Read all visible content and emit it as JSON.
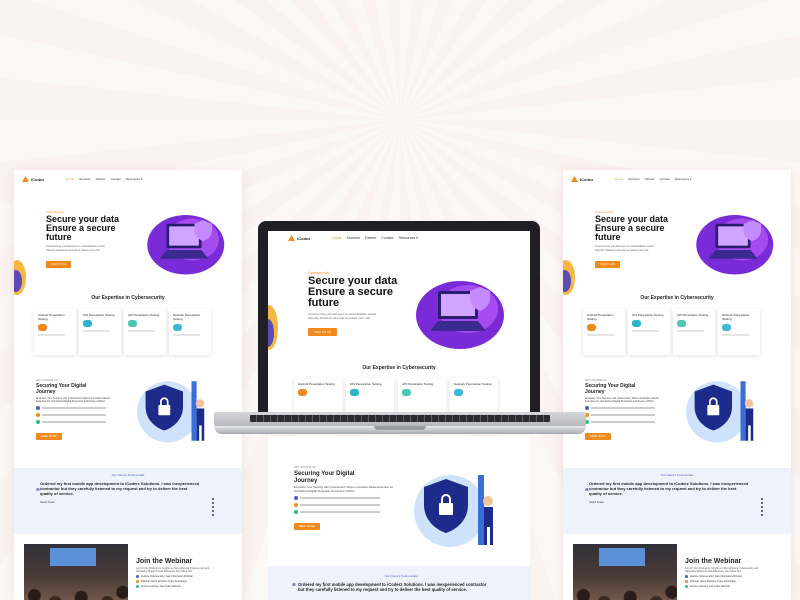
{
  "nav": {
    "logo_text": "iCodez",
    "links": [
      "Home",
      "Services",
      "Partner",
      "Contact",
      "Resources ▾"
    ]
  },
  "hero": {
    "eyebrow": "Cybersecurity",
    "title": "Secure your data Ensure a secure future",
    "text": "Avoid turning yourself open to vulnerabilities. Avoid Security Solutions can help to reduce your risk.",
    "button": "TALK TO US"
  },
  "expertise": {
    "title": "Our Expertise in Cybersecurity",
    "cards": [
      {
        "title": "Android Penetration Testing",
        "icon_color": "#f08a1c"
      },
      {
        "title": "iOS Penetration Testing",
        "icon_color": "#2bb3c9"
      },
      {
        "title": "API Penetration Testing",
        "icon_color": "#4bc7b3"
      },
      {
        "title": "Network Penetration Testing",
        "icon_color": "#3db8d8"
      }
    ]
  },
  "secure": {
    "eyebrow": "WHY CHOOSE US",
    "title": "Securing Your Digital Journey",
    "text": "Empower Your Security with CyberGuard: Where Innovation Meets Expertise for Unmatched Digital Protection and Peace of Mind",
    "button": "READ MORE",
    "bullet_colors": [
      "#4a5bd1",
      "#f08a1c",
      "#2bbf7a"
    ]
  },
  "testimonial": {
    "eyebrow": "Our Client's Testimonials",
    "quote": "Ordered my first mobile app development to iCoderz Solutions. I was inexperienced contractor but they carefully listened to my request and try to deliver the best quality of service.",
    "name": "Saahil Shaan"
  },
  "webinar": {
    "title": "Join the Webinar",
    "text": "Join for Our Webinar for Insights on Strengthening Cybersecurity and Navigating Digital Threats Effectively. Don't Miss Out!",
    "items": [
      "Explore Cybersecurity: Gain Information Webinar",
      "Webinar: Alerts Enhance Cyber Knowledge",
      "Secure Learning: Join Cyber Webinar"
    ]
  },
  "colors": {
    "accent": "#f08a1c",
    "purple": "#7a2bd8",
    "navy": "#1d2b8a",
    "light_blue": "#eef3fb"
  }
}
